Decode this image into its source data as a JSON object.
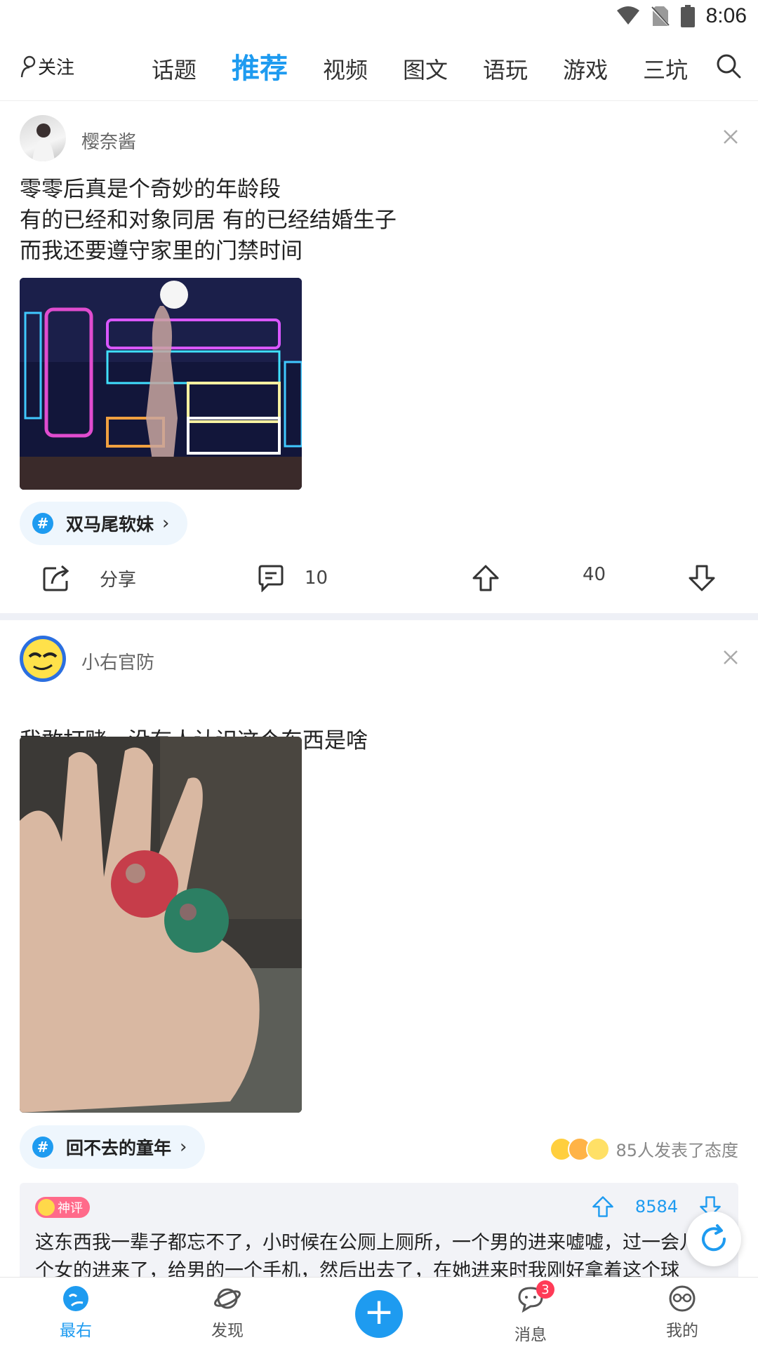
{
  "status_bar": {
    "time": "8:06"
  },
  "top_nav": {
    "follow_label": "关注",
    "tabs": [
      {
        "label": "话题",
        "active": false
      },
      {
        "label": "推荐",
        "active": true
      },
      {
        "label": "视频",
        "active": false
      },
      {
        "label": "图文",
        "active": false
      },
      {
        "label": "语玩",
        "active": false
      },
      {
        "label": "游戏",
        "active": false
      },
      {
        "label": "三坑",
        "active": false
      }
    ]
  },
  "posts": [
    {
      "author": "樱奈酱",
      "text": "零零后真是个奇妙的年龄段\n有的已经和对象同居 有的已经结婚生子\n而我还要遵守家里的门禁时间",
      "topic": "双马尾软妹",
      "share_label": "分享",
      "comments": "10",
      "likes": "40"
    },
    {
      "author": "小右官防",
      "text": "我敢打赌，没有人认识这个东西是啥",
      "topic": "回不去的童年",
      "reactions_text": "85人发表了态度",
      "god_comment": {
        "badge": "神评",
        "likes": "8584",
        "text": "这东西我一辈子都忘不了，小时候在公厕上厕所，一个男的进来嘘嘘，过一会儿一个女的进来了，给男的一个手机，然后出去了，在她进来时我刚好拿着这个球"
      }
    }
  ],
  "bottom_nav": {
    "items": [
      {
        "label": "最右",
        "active": true
      },
      {
        "label": "发现",
        "active": false
      },
      {
        "label": "消息",
        "active": false,
        "badge": "3"
      },
      {
        "label": "我的",
        "active": false
      }
    ]
  },
  "colors": {
    "accent": "#1e9bf0",
    "badge_red": "#ff3b57",
    "god_badge": "#ff6a8a"
  }
}
